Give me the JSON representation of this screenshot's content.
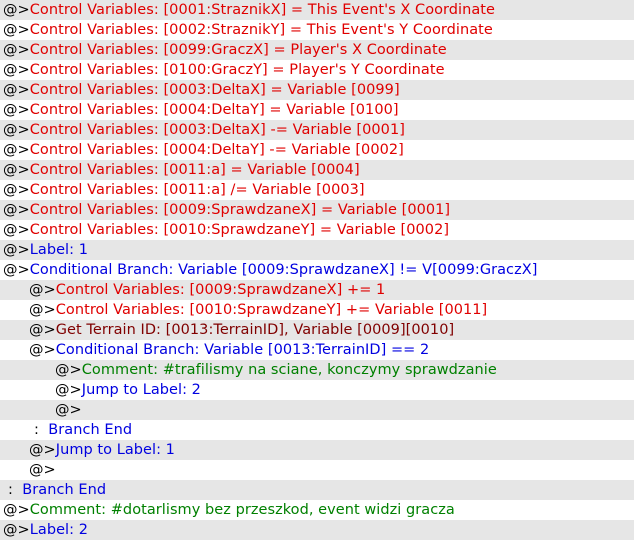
{
  "marker": "@>",
  "colors": {
    "control": "#e00000",
    "flow": "#0000e0",
    "terrain": "#800000",
    "comment": "#008000",
    "row_alt": "#e6e6e6"
  },
  "commands": [
    {
      "indent": 0,
      "marker": true,
      "color": "red",
      "text": "Control Variables: [0001:StraznikX] = This Event's X Coordinate"
    },
    {
      "indent": 0,
      "marker": true,
      "color": "red",
      "text": "Control Variables: [0002:StraznikY] = This Event's Y Coordinate"
    },
    {
      "indent": 0,
      "marker": true,
      "color": "red",
      "text": "Control Variables: [0099:GraczX] = Player's X Coordinate"
    },
    {
      "indent": 0,
      "marker": true,
      "color": "red",
      "text": "Control Variables: [0100:GraczY] = Player's Y Coordinate"
    },
    {
      "indent": 0,
      "marker": true,
      "color": "red",
      "text": "Control Variables: [0003:DeltaX] = Variable [0099]"
    },
    {
      "indent": 0,
      "marker": true,
      "color": "red",
      "text": "Control Variables: [0004:DeltaY] = Variable [0100]"
    },
    {
      "indent": 0,
      "marker": true,
      "color": "red",
      "text": "Control Variables: [0003:DeltaX] -= Variable [0001]"
    },
    {
      "indent": 0,
      "marker": true,
      "color": "red",
      "text": "Control Variables: [0004:DeltaY] -= Variable [0002]"
    },
    {
      "indent": 0,
      "marker": true,
      "color": "red",
      "text": "Control Variables: [0011:a] = Variable [0004]"
    },
    {
      "indent": 0,
      "marker": true,
      "color": "red",
      "text": "Control Variables: [0011:a] /= Variable [0003]"
    },
    {
      "indent": 0,
      "marker": true,
      "color": "red",
      "text": "Control Variables: [0009:SprawdzaneX] = Variable [0001]"
    },
    {
      "indent": 0,
      "marker": true,
      "color": "red",
      "text": "Control Variables: [0010:SprawdzaneY] = Variable [0002]"
    },
    {
      "indent": 0,
      "marker": true,
      "color": "blue",
      "text": "Label: 1"
    },
    {
      "indent": 0,
      "marker": true,
      "color": "blue",
      "text": "Conditional Branch: Variable [0009:SprawdzaneX] != V[0099:GraczX]"
    },
    {
      "indent": 1,
      "marker": true,
      "color": "red",
      "text": "Control Variables: [0009:SprawdzaneX] += 1"
    },
    {
      "indent": 1,
      "marker": true,
      "color": "red",
      "text": "Control Variables: [0010:SprawdzaneY] += Variable [0011]"
    },
    {
      "indent": 1,
      "marker": true,
      "color": "darkred",
      "text": "Get Terrain ID: [0013:TerrainID], Variable [0009][0010]"
    },
    {
      "indent": 1,
      "marker": true,
      "color": "blue",
      "text": "Conditional Branch: Variable [0013:TerrainID] == 2"
    },
    {
      "indent": 2,
      "marker": true,
      "color": "green",
      "text": "Comment: #trafilismy na sciane, konczymy sprawdzanie"
    },
    {
      "indent": 2,
      "marker": true,
      "color": "blue",
      "text": "Jump to Label: 2"
    },
    {
      "indent": 2,
      "marker": true,
      "color": "black",
      "text": ""
    },
    {
      "indent": 1,
      "marker": false,
      "color": "blue",
      "prefix": ":",
      "text": "Branch End"
    },
    {
      "indent": 1,
      "marker": true,
      "color": "blue",
      "text": "Jump to Label: 1"
    },
    {
      "indent": 1,
      "marker": true,
      "color": "black",
      "text": ""
    },
    {
      "indent": 0,
      "marker": false,
      "color": "blue",
      "prefix": ":",
      "text": "Branch End"
    },
    {
      "indent": 0,
      "marker": true,
      "color": "green",
      "text": "Comment: #dotarlismy bez przeszkod, event widzi gracza"
    },
    {
      "indent": 0,
      "marker": true,
      "color": "blue",
      "text": "Label: 2"
    }
  ]
}
